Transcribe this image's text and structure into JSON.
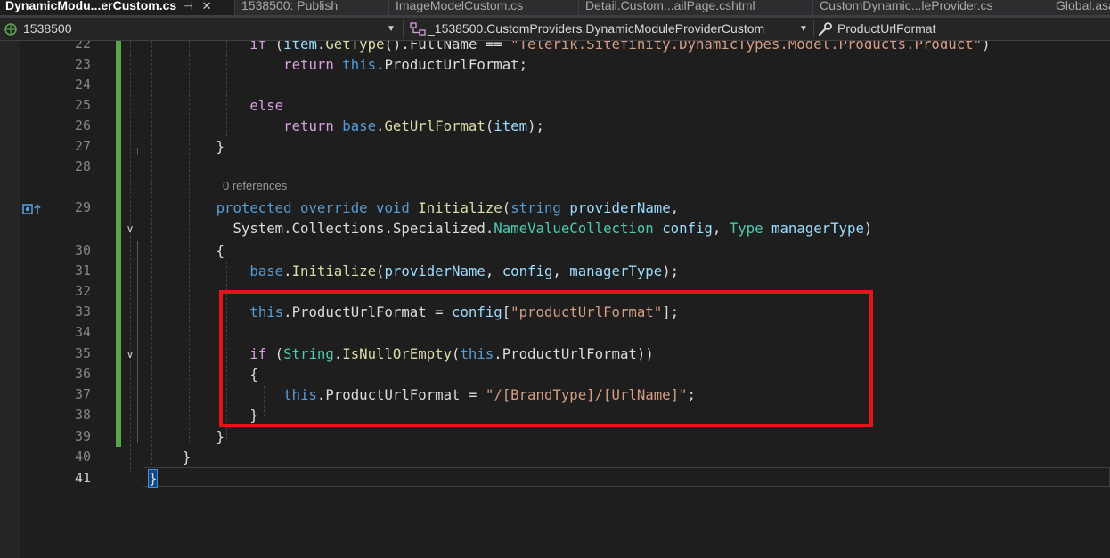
{
  "tabs": [
    {
      "label": "DynamicModu...erCustom.cs",
      "active": true
    },
    {
      "label": "1538500: Publish",
      "active": false
    },
    {
      "label": "ImageModelCustom.cs",
      "active": false
    },
    {
      "label": "Detail.Custom...ailPage.cshtml",
      "active": false
    },
    {
      "label": "CustomDynamic...leProvider.cs",
      "active": false
    },
    {
      "label": "Global.asax",
      "active": false
    }
  ],
  "navbar": {
    "project": "1538500",
    "type": "_1538500.CustomProviders.DynamicModuleProviderCustom",
    "member": "ProductUrlFormat"
  },
  "editor": {
    "line_numbers": [
      "22",
      "23",
      "24",
      "25",
      "26",
      "27",
      "28",
      "29",
      "30",
      "31",
      "32",
      "33",
      "34",
      "35",
      "36",
      "37",
      "38",
      "39",
      "40",
      "41"
    ],
    "current_line": "41",
    "codelens": "0 references",
    "line22": {
      "if": "if",
      "item": "item",
      "getType": "GetType",
      "fullName": "FullName",
      "str": "\"Telerik.Sitefinity.DynamicTypes.Model.Products.Product\""
    },
    "line23": {
      "ret": "return",
      "this": "this",
      "prop": "ProductUrlFormat"
    },
    "line25": {
      "else": "else"
    },
    "line26": {
      "ret": "return",
      "base": "base",
      "method": "GetUrlFormat",
      "arg": "item"
    },
    "line29": {
      "protected": "protected",
      "override": "override",
      "void": "void",
      "method": "Initialize",
      "string": "string",
      "param": "providerName"
    },
    "line29b": {
      "system": "System",
      "collections": "Collections",
      "specialized": "Specialized",
      "nvc": "NameValueCollection",
      "config": "config",
      "type": "Type",
      "managerType": "managerType"
    },
    "line31": {
      "base": "base",
      "method": "Initialize",
      "a1": "providerName",
      "a2": "config",
      "a3": "managerType"
    },
    "line33": {
      "this": "this",
      "prop": "ProductUrlFormat",
      "config": "config",
      "key": "\"productUrlFormat\""
    },
    "line35": {
      "if": "if",
      "string": "String",
      "method": "IsNullOrEmpty",
      "this": "this",
      "prop": "ProductUrlFormat"
    },
    "line37": {
      "this": "this",
      "prop": "ProductUrlFormat",
      "value": "\"/[BrandType]/[UrlName]\""
    }
  },
  "colors": {
    "highlight_box": "#e5141b",
    "change_bar": "#57a64a",
    "keyword": "#569cd6",
    "control": "#d8a0df",
    "type": "#4ec9b0",
    "method": "#dcdcaa",
    "parameter": "#9cdcfe",
    "string": "#d69d85"
  },
  "icons": {
    "file_icon": "project-file-icon",
    "type_icon": "class-structure-icon",
    "member_icon": "wrench-icon",
    "gutter_icon": "override-marker-icon"
  }
}
